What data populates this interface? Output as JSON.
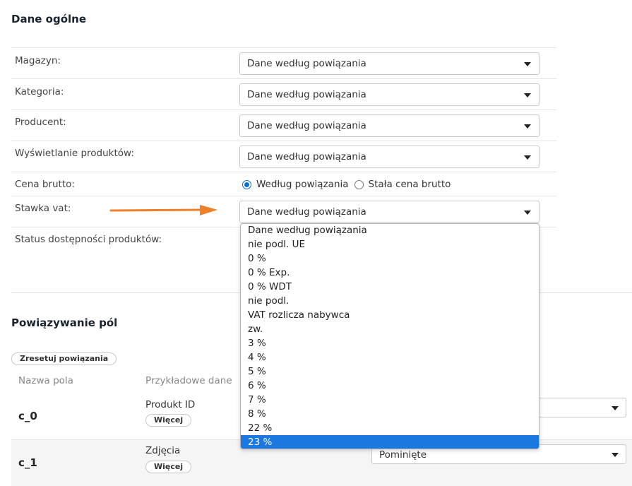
{
  "general": {
    "title": "Dane ogólne",
    "rows": [
      {
        "label": "Magazyn:",
        "value": "Dane według powiązania"
      },
      {
        "label": "Kategoria:",
        "value": "Dane według powiązania"
      },
      {
        "label": "Producent:",
        "value": "Dane według powiązania"
      },
      {
        "label": "Wyświetlanie produktów:",
        "value": "Dane według powiązania"
      }
    ],
    "gross_price": {
      "label": "Cena brutto:",
      "options": [
        {
          "label": "Według powiązania",
          "checked": true
        },
        {
          "label": "Stała cena brutto",
          "checked": false
        }
      ]
    },
    "vat_rate": {
      "label": "Stawka vat:",
      "value": "Dane według powiązania",
      "options": [
        "Dane według powiązania",
        "nie podl. UE",
        "0 %",
        "0 % Exp.",
        "0 % WDT",
        "nie podl.",
        "VAT rozlicza nabywca",
        "zw.",
        "3 %",
        "4 %",
        "5 %",
        "6 %",
        "7 %",
        "8 %",
        "22 %",
        "23 %"
      ],
      "highlighted": "23 %"
    },
    "availability": {
      "label": "Status dostępności produktów:"
    }
  },
  "mapping": {
    "title": "Powiązywanie pól",
    "reset_label": "Zresetuj powiązania",
    "columns": {
      "field_name": "Nazwa pola",
      "sample_data": "Przykładowe dane"
    },
    "rows": [
      {
        "name": "c_0",
        "sample": "Produkt ID",
        "more_label": "Więcej",
        "target": ""
      },
      {
        "name": "c_1",
        "sample": "Zdjęcia",
        "more_label": "Więcej",
        "target": "Pominięte"
      }
    ]
  },
  "colors": {
    "accent": "#1a78e0",
    "arrow": "#f07f2a",
    "title": "#1b2331"
  },
  "icons": {
    "dropdown": "caret-down-icon",
    "arrow": "arrow-right-icon"
  }
}
